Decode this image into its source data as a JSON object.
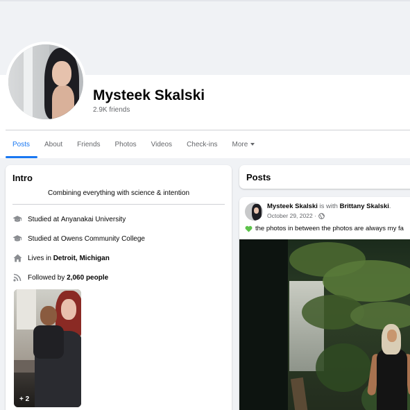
{
  "profile": {
    "name": "Mysteek Skalski",
    "friends": "2.9K friends"
  },
  "tabs": [
    {
      "label": "Posts",
      "active": true
    },
    {
      "label": "About"
    },
    {
      "label": "Friends"
    },
    {
      "label": "Photos"
    },
    {
      "label": "Videos"
    },
    {
      "label": "Check-ins"
    },
    {
      "label": "More"
    }
  ],
  "intro": {
    "title": "Intro",
    "bio": "Combining everything with science & intention",
    "items": [
      {
        "icon": "graduation-cap-icon",
        "prefix": "Studied at ",
        "value": "Anyanakai University",
        "bold": false
      },
      {
        "icon": "graduation-cap-icon",
        "prefix": "Studied at ",
        "value": "Owens Community College",
        "bold": false
      },
      {
        "icon": "home-icon",
        "prefix": "Lives in ",
        "value": "Detroit, Michigan",
        "bold": true
      },
      {
        "icon": "rss-icon",
        "prefix": "Followed by ",
        "value": "2,060 people",
        "bold": true
      }
    ],
    "photos_more": "+ 2"
  },
  "posts_header": {
    "title": "Posts"
  },
  "post": {
    "author": "Mysteek Skalski",
    "with_text": " is with ",
    "tagged": "Brittany Skalski",
    "tail": ".",
    "date": "October 29, 2022 ·",
    "privacy_icon": "globe-icon",
    "emoji_icon": "green-heart-icon",
    "text": "the photos in between the photos are always my fa"
  },
  "colors": {
    "accent": "#1877f2",
    "secondary_text": "#65676b",
    "background": "#f0f2f5",
    "heart": "#5cc24a"
  }
}
